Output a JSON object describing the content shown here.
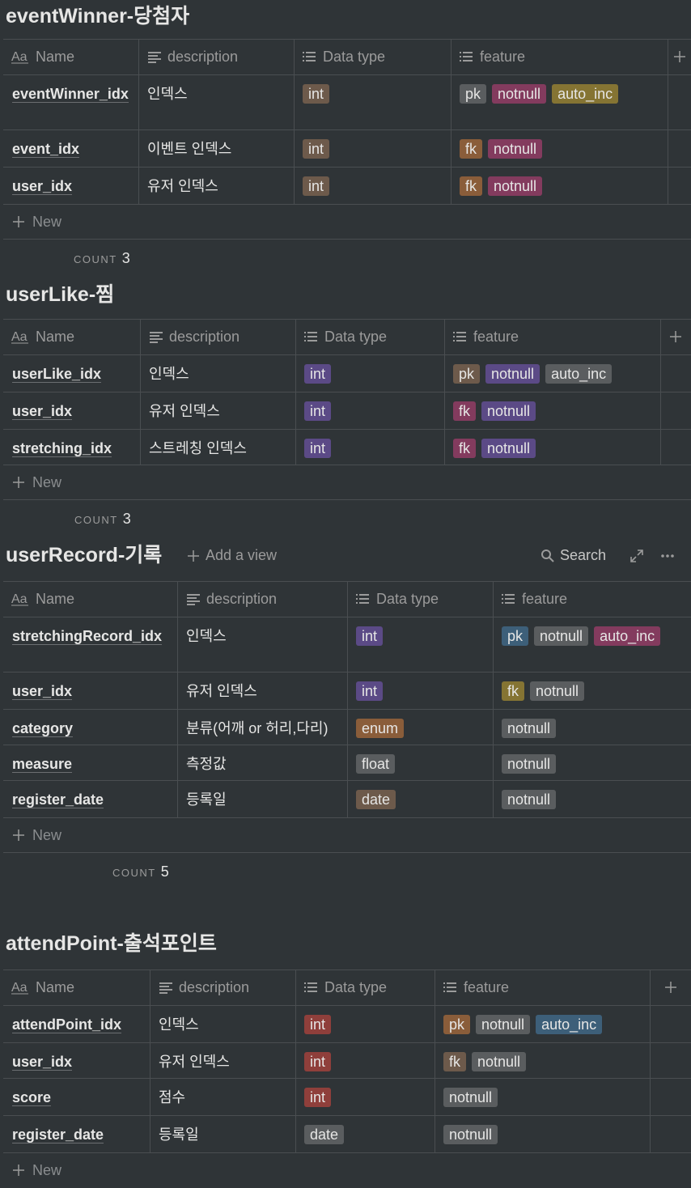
{
  "colors": {
    "background": "#2f3437",
    "gray": "#5a5d5f",
    "brown": "#6d5a4b",
    "orange": "#8a5d3a",
    "purple": "#5b4a86",
    "pink": "#833b5e",
    "red": "#8f3f3b",
    "yellow": "#857433",
    "blue": "#3d5f79"
  },
  "header_labels": {
    "name": "Name",
    "description": "description",
    "data_type": "Data type",
    "feature": "feature",
    "new": "New",
    "count": "COUNT"
  },
  "databases": [
    {
      "title": "eventWinner-당첨자",
      "count": "3",
      "rows": [
        {
          "name": "eventWinner_idx",
          "description": "인덱스",
          "type": {
            "label": "int",
            "color": "brown"
          },
          "features": [
            {
              "label": "pk",
              "color": "gray"
            },
            {
              "label": "notnull",
              "color": "pink"
            },
            {
              "label": "auto_inc",
              "color": "yellow"
            }
          ]
        },
        {
          "name": "event_idx",
          "description": "이벤트 인덱스",
          "type": {
            "label": "int",
            "color": "brown"
          },
          "features": [
            {
              "label": "fk",
              "color": "orange"
            },
            {
              "label": "notnull",
              "color": "pink"
            }
          ]
        },
        {
          "name": "user_idx",
          "description": "유저 인덱스",
          "type": {
            "label": "int",
            "color": "brown"
          },
          "features": [
            {
              "label": "fk",
              "color": "orange"
            },
            {
              "label": "notnull",
              "color": "pink"
            }
          ]
        }
      ]
    },
    {
      "title": "userLike-찜",
      "count": "3",
      "rows": [
        {
          "name": "userLike_idx",
          "description": "인덱스",
          "type": {
            "label": "int",
            "color": "purple"
          },
          "features": [
            {
              "label": "pk",
              "color": "brown"
            },
            {
              "label": "notnull",
              "color": "purple"
            },
            {
              "label": "auto_inc",
              "color": "gray"
            }
          ]
        },
        {
          "name": "user_idx",
          "description": "유저 인덱스",
          "type": {
            "label": "int",
            "color": "purple"
          },
          "features": [
            {
              "label": "fk",
              "color": "pink"
            },
            {
              "label": "notnull",
              "color": "purple"
            }
          ]
        },
        {
          "name": "stretching_idx",
          "description": "스트레칭 인덱스",
          "type": {
            "label": "int",
            "color": "purple"
          },
          "features": [
            {
              "label": "fk",
              "color": "pink"
            },
            {
              "label": "notnull",
              "color": "purple"
            }
          ]
        }
      ]
    },
    {
      "title": "userRecord-기록",
      "add_view": "Add a view",
      "search": "Search",
      "count": "5",
      "rows": [
        {
          "name": "stretchingRecord_idx",
          "description": "인덱스",
          "type": {
            "label": "int",
            "color": "purple"
          },
          "features": [
            {
              "label": "pk",
              "color": "blue"
            },
            {
              "label": "notnull",
              "color": "gray"
            },
            {
              "label": "auto_inc",
              "color": "pink"
            }
          ]
        },
        {
          "name": "user_idx",
          "description": "유저 인덱스",
          "type": {
            "label": "int",
            "color": "purple"
          },
          "features": [
            {
              "label": "fk",
              "color": "yellow"
            },
            {
              "label": "notnull",
              "color": "gray"
            }
          ]
        },
        {
          "name": "category",
          "description": "분류(어깨 or 허리,다리)",
          "type": {
            "label": "enum",
            "color": "orange"
          },
          "features": [
            {
              "label": "notnull",
              "color": "gray"
            }
          ]
        },
        {
          "name": "measure",
          "description": "측정값",
          "type": {
            "label": "float",
            "color": "gray"
          },
          "features": [
            {
              "label": "notnull",
              "color": "gray"
            }
          ]
        },
        {
          "name": "register_date",
          "description": "등록일",
          "type": {
            "label": "date",
            "color": "brown"
          },
          "features": [
            {
              "label": "notnull",
              "color": "gray"
            }
          ]
        }
      ]
    },
    {
      "title": "attendPoint-출석포인트",
      "rows": [
        {
          "name": "attendPoint_idx",
          "description": "인덱스",
          "type": {
            "label": "int",
            "color": "red"
          },
          "features": [
            {
              "label": "pk",
              "color": "orange"
            },
            {
              "label": "notnull",
              "color": "gray"
            },
            {
              "label": "auto_inc",
              "color": "blue"
            }
          ]
        },
        {
          "name": "user_idx",
          "description": "유저 인덱스",
          "type": {
            "label": "int",
            "color": "red"
          },
          "features": [
            {
              "label": "fk",
              "color": "brown"
            },
            {
              "label": "notnull",
              "color": "gray"
            }
          ]
        },
        {
          "name": "score",
          "description": "점수",
          "type": {
            "label": "int",
            "color": "red"
          },
          "features": [
            {
              "label": "notnull",
              "color": "gray"
            }
          ]
        },
        {
          "name": "register_date",
          "description": "등록일",
          "type": {
            "label": "date",
            "color": "gray"
          },
          "features": [
            {
              "label": "notnull",
              "color": "gray"
            }
          ]
        }
      ]
    }
  ]
}
